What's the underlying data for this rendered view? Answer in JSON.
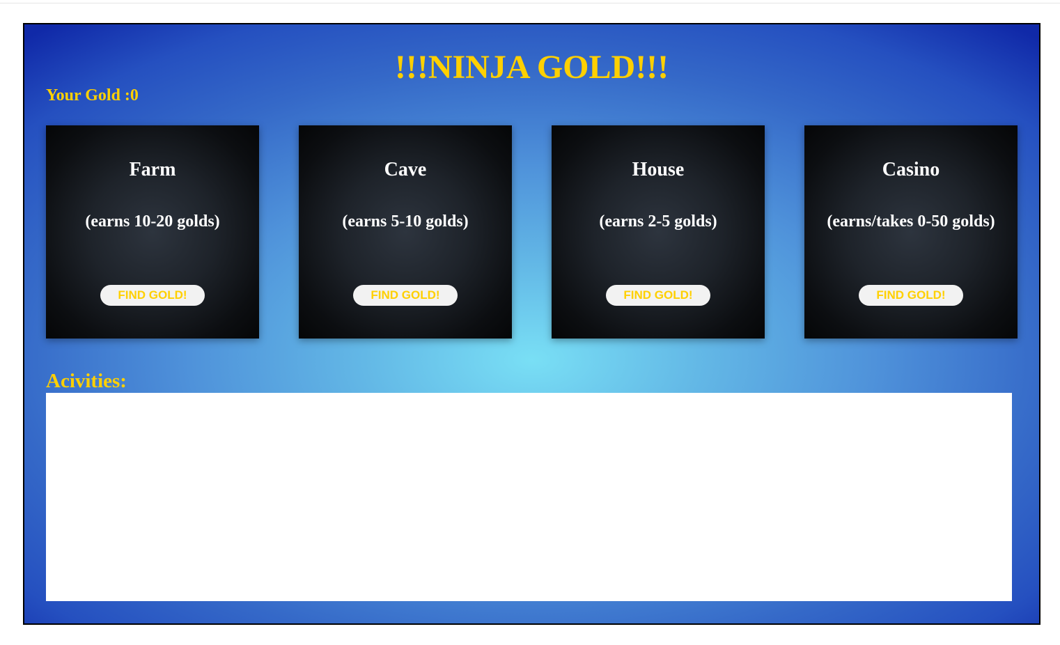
{
  "header": {
    "title": "!!!NINJA GOLD!!!",
    "gold_text": "Your Gold :0"
  },
  "locations": [
    {
      "name": "Farm",
      "description": "(earns 10-20 golds)",
      "button_label": "FIND GOLD!"
    },
    {
      "name": "Cave",
      "description": "(earns 5-10 golds)",
      "button_label": "FIND GOLD!"
    },
    {
      "name": "House",
      "description": "(earns 2-5 golds)",
      "button_label": "FIND GOLD!"
    },
    {
      "name": "Casino",
      "description": "(earns/takes 0-50 golds)",
      "button_label": "FIND GOLD!"
    }
  ],
  "activities": {
    "label": "Acivities:",
    "entries": []
  },
  "colors": {
    "accent_gold": "#ffd000",
    "card_text": "#ffffff",
    "background_center": "#79dff5",
    "background_edge": "#1029a8"
  }
}
